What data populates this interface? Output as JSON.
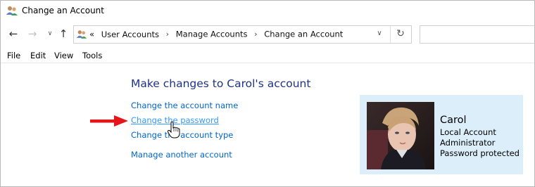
{
  "window": {
    "title": "Change an Account"
  },
  "nav": {
    "back_icon": "back-arrow-icon",
    "forward_icon": "forward-arrow-icon",
    "recent_icon": "chevron-down-icon",
    "up_icon": "up-arrow-icon"
  },
  "address": {
    "overflow": "«",
    "crumbs": [
      "User Accounts",
      "Manage Accounts",
      "Change an Account"
    ],
    "separator": "›"
  },
  "menu": {
    "items": [
      "File",
      "Edit",
      "View",
      "Tools"
    ]
  },
  "main": {
    "heading": "Make changes to Carol's account",
    "links": {
      "change_name": "Change the account name",
      "change_password": "Change the password",
      "change_type": "Change the account type",
      "manage_another": "Manage another account"
    }
  },
  "account": {
    "name": "Carol",
    "details": [
      "Local Account",
      "Administrator",
      "Password protected"
    ]
  },
  "colors": {
    "heading": "#1e3287",
    "link": "#0066cc",
    "panel_bg": "#ddeefb",
    "arrow": "#e8141b"
  }
}
